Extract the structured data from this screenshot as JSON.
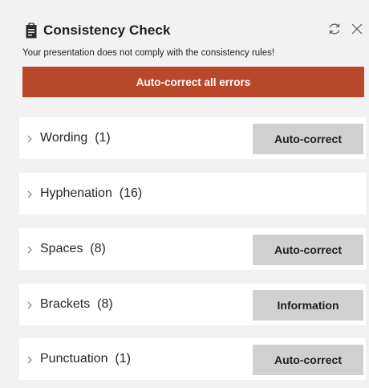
{
  "header": {
    "title": "Consistency Check",
    "subtitle": "Your presentation does not comply with the consistency rules!",
    "autocorrect_all_label": "Auto-correct all errors"
  },
  "groups": [
    {
      "label": "Wording",
      "count": "(1)",
      "button": "Auto-correct"
    },
    {
      "label": "Hyphenation",
      "count": "(16)",
      "button": null
    },
    {
      "label": "Spaces",
      "count": "(8)",
      "button": "Auto-correct"
    },
    {
      "label": "Brackets",
      "count": "(8)",
      "button": "Information"
    },
    {
      "label": "Punctuation",
      "count": "(1)",
      "button": "Auto-correct"
    }
  ],
  "colors": {
    "accent": "#b9472a",
    "panel_bg": "#f2f2f2",
    "card_bg": "#ffffff",
    "button_bg": "#d0d0d0"
  },
  "icons": {
    "title_icon": "clipboard-icon",
    "refresh": "refresh-icon",
    "close": "close-icon",
    "expand": "chevron-right-icon"
  }
}
